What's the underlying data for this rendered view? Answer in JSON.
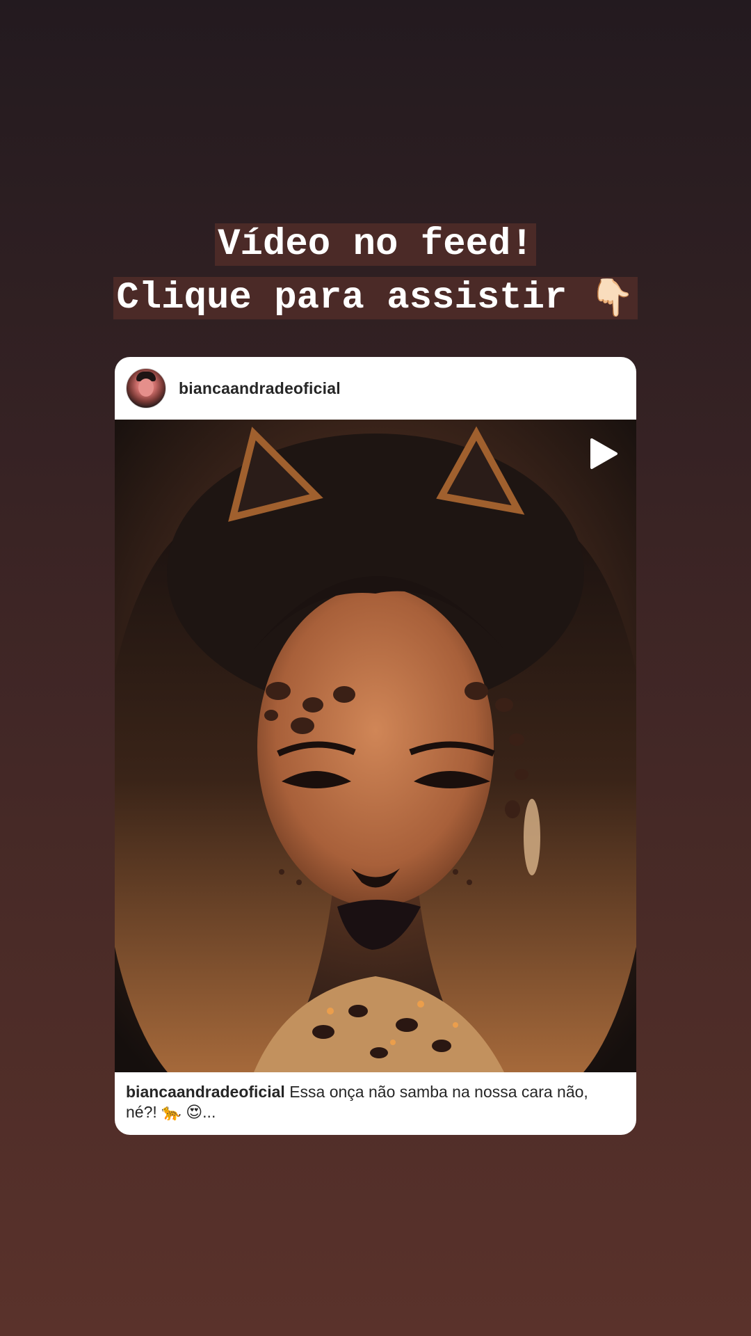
{
  "story": {
    "headline_line1": "Vídeo no feed!",
    "headline_line2": "Clique para assistir",
    "pointer_emoji": "👇🏻",
    "pointer_icon": "pointing-down-hand-icon",
    "highlight_color": "#4b2a27"
  },
  "post": {
    "username": "biancaandradeoficial",
    "media_type": "video",
    "play_icon": "play-icon",
    "caption_user": "biancaandradeoficial",
    "caption_text": "Essa onça não samba na nossa cara não, né?!",
    "caption_emoji_1": "🐆",
    "caption_emoji_2": "😍",
    "caption_more": "..."
  }
}
